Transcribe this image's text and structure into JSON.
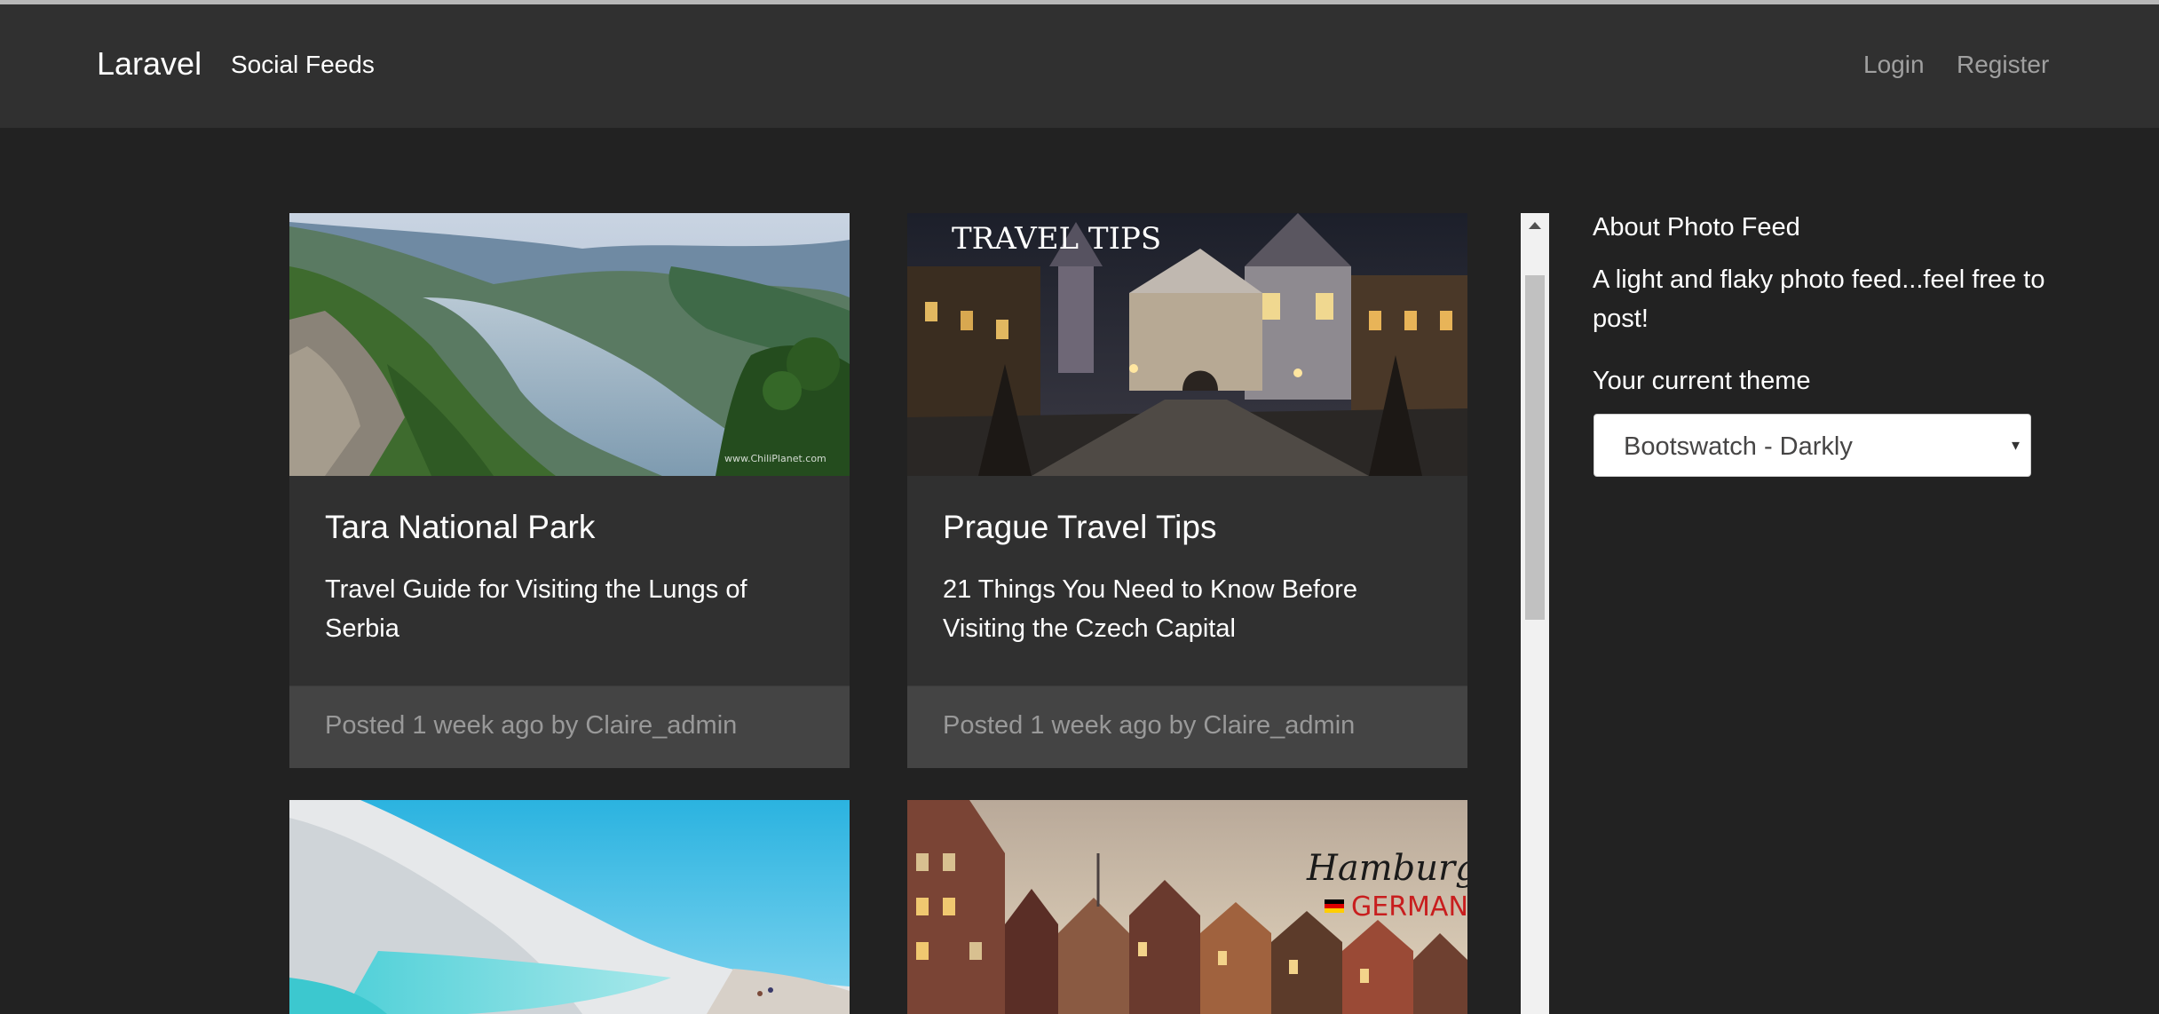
{
  "navbar": {
    "brand": "Laravel",
    "social_feeds": "Social Feeds",
    "login": "Login",
    "register": "Register"
  },
  "posts": [
    {
      "title": "Tara National Park",
      "subtitle": "Travel Guide for Visiting the Lungs of Serbia",
      "footer": "Posted 1 week ago by Claire_admin",
      "image_watermark": "www.ChiliPlanet.com"
    },
    {
      "title": "Prague Travel Tips",
      "subtitle": "21 Things You Need to Know Before Visiting the Czech Capital",
      "footer": "Posted 1 week ago by Claire_admin",
      "image_overlay": "TRAVEL TIPS"
    },
    {
      "image_name": "pamukkale-travertines"
    },
    {
      "image_overlay_line1": "Hamburg",
      "image_overlay_line2": "GERMANY"
    }
  ],
  "sidebar": {
    "heading": "About Photo Feed",
    "description": "A light and flaky photo feed...feel free to post!",
    "theme_label": "Your current theme",
    "theme_value": "Bootswatch - Darkly"
  },
  "colors": {
    "background": "#222222",
    "navbar": "#303030",
    "card": "#303030",
    "card_footer": "#444444",
    "muted_text": "#999999"
  }
}
